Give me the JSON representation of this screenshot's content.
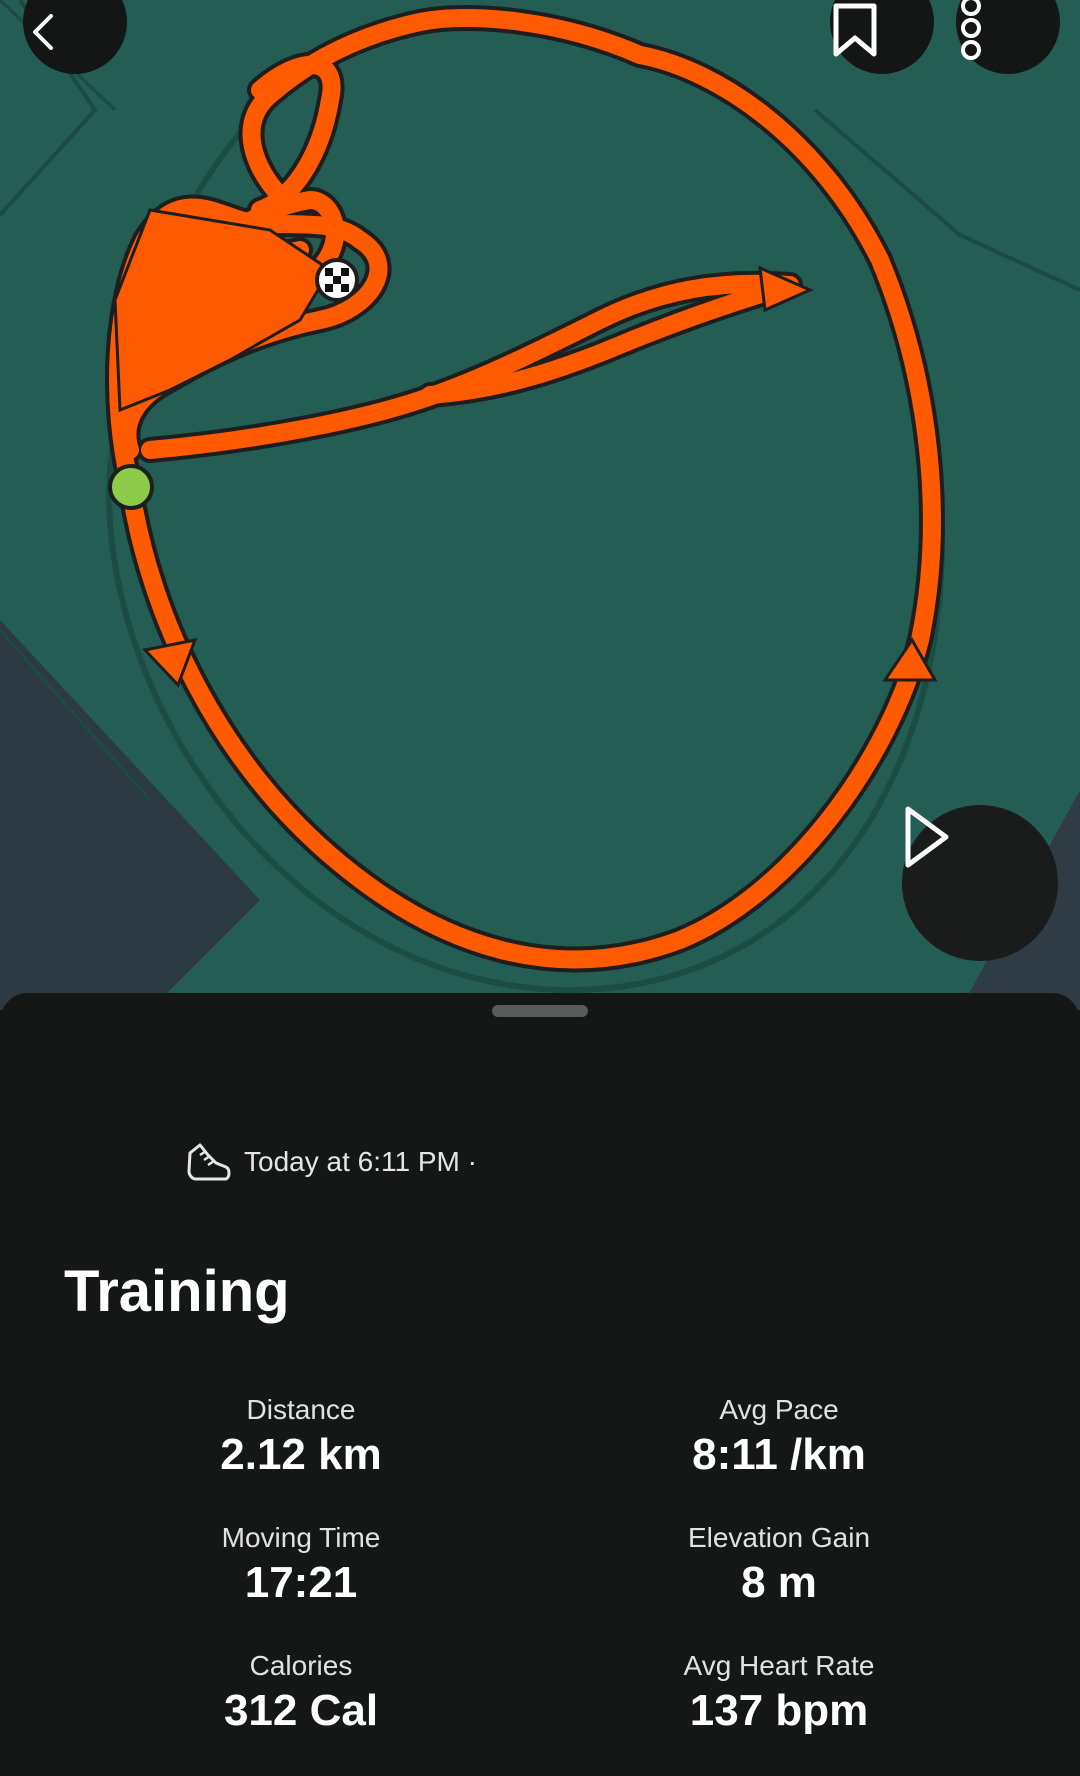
{
  "header": {
    "back_icon": "chevron-left-icon",
    "bookmark_icon": "bookmark-icon",
    "more_icon": "more-vertical-icon"
  },
  "map": {
    "route_color": "#ff5a00",
    "start_marker_color": "#8ccc4a",
    "finish_marker_icon": "checkered-flag-icon",
    "play_icon": "play-icon"
  },
  "activity": {
    "sport_icon": "running-shoe-icon",
    "timestamp": "Today at 6:11 PM ·",
    "title": "Training"
  },
  "stats": [
    {
      "label": "Distance",
      "value": "2.12 km"
    },
    {
      "label": "Avg Pace",
      "value": "8:11 /km"
    },
    {
      "label": "Moving Time",
      "value": "17:21"
    },
    {
      "label": "Elevation Gain",
      "value": "8 m"
    },
    {
      "label": "Calories",
      "value": "312 Cal"
    },
    {
      "label": "Avg Heart Rate",
      "value": "137 bpm"
    }
  ]
}
